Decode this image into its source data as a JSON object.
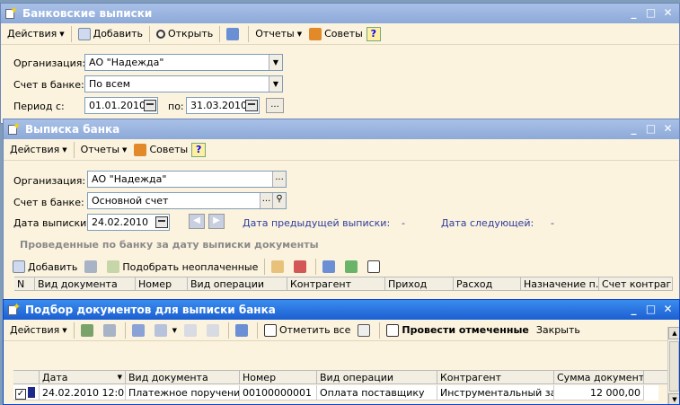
{
  "win1": {
    "title": "Банковские выписки",
    "toolbar": {
      "actions": "Действия",
      "add": "Добавить",
      "open": "Открыть",
      "reports": "Отчеты",
      "tips": "Советы",
      "help": "?"
    },
    "org_label": "Организация:",
    "org_value": "АО \"Надежда\"",
    "account_label": "Счет в банке:",
    "account_value": "По всем",
    "period_label": "Период с:",
    "period_from": "01.01.2010",
    "period_to_label": "по:",
    "period_to": "31.03.2010",
    "more": "..."
  },
  "win2": {
    "title": "Выписка банка",
    "toolbar": {
      "actions": "Действия",
      "reports": "Отчеты",
      "tips": "Советы",
      "help": "?"
    },
    "org_label": "Организация:",
    "org_value": "АО \"Надежда\"",
    "account_label": "Счет в банке:",
    "account_value": "Основной счет",
    "date_label": "Дата выписки:",
    "date_value": "24.02.2010",
    "prev_label": "Дата предыдущей выписки:",
    "prev_value": "-",
    "next_label": "Дата следующей:",
    "next_value": "-",
    "section_title": "Проведенные по банку за дату выписки документы",
    "grid_toolbar": {
      "add": "Добавить",
      "pick_unpaid": "Подобрать неоплаченные"
    },
    "columns": [
      "N",
      "Вид документа",
      "Номер",
      "Вид операции",
      "Контрагент",
      "Приход",
      "Расход",
      "Назначение п...",
      "Счет контраге..."
    ]
  },
  "win3": {
    "title": "Подбор документов для выписки банка",
    "toolbar": {
      "actions": "Действия",
      "mark_all": "Отметить все",
      "post_marked": "Провести отмеченные",
      "close": "Закрыть"
    },
    "columns": [
      "Дата",
      "Вид документа",
      "Номер",
      "Вид операции",
      "Контрагент",
      "Сумма документа"
    ],
    "rows": [
      {
        "date": "24.02.2010 12:0...",
        "doc_type": "Платежное поручение...",
        "number": "00100000001",
        "operation": "Оплата поставщику",
        "counterparty": "Инструментальный за...",
        "amount": "12 000,00"
      }
    ]
  }
}
